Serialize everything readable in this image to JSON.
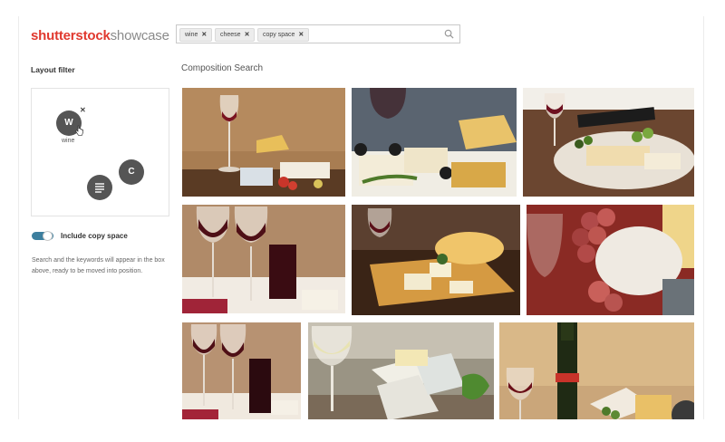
{
  "header": {
    "logo_brand": "shutterstock",
    "logo_sub": "showcase",
    "tags": [
      {
        "label": "wine"
      },
      {
        "label": "cheese"
      },
      {
        "label": "copy space"
      }
    ],
    "search_icon": "search-icon"
  },
  "sidebar": {
    "title": "Layout filter",
    "filter_circles": [
      {
        "letter": "W",
        "label": "wine"
      },
      {
        "letter": "C"
      },
      {
        "icon": "text-lines-icon"
      }
    ],
    "toggle_label": "Include copy space",
    "toggle_on": true,
    "help_text": "Search and the keywords will appear in the box above, ready to be moved into position."
  },
  "main": {
    "title": "Composition Search",
    "images": [
      {
        "subject": "red wine glass with cheese on wooden table"
      },
      {
        "subject": "cheese platter with grapes and wine"
      },
      {
        "subject": "cheese board with grapes and wine bottle"
      },
      {
        "subject": "two glasses of red wine with carafe and cheese"
      },
      {
        "subject": "cheese and crackers on wooden board with wine"
      },
      {
        "subject": "brie and blue cheese with grapes"
      },
      {
        "subject": "glasses of red wine with cheese cubes"
      },
      {
        "subject": "blue cheese and white wine"
      },
      {
        "subject": "red wine bottle and glass with cheese"
      }
    ]
  },
  "colors": {
    "brand_red": "#e0382e",
    "toggle_blue": "#3d7f9e",
    "circle_gray": "#555555"
  }
}
